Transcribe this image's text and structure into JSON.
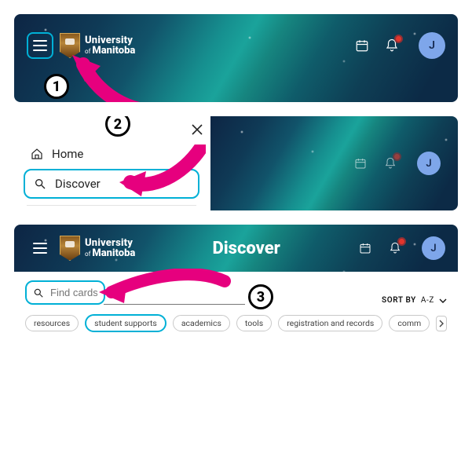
{
  "university": {
    "line1": "University",
    "line2_prefix": "of",
    "line2": "Manitoba"
  },
  "topbar": {
    "avatar_initial": "J"
  },
  "steps": {
    "one": "1",
    "two": "2",
    "three": "3"
  },
  "sidebar": {
    "home": "Home",
    "discover": "Discover"
  },
  "discover": {
    "page_title": "Discover",
    "find_placeholder": "Find cards",
    "sort_label": "SORT BY",
    "sort_value": "A-Z",
    "chips": [
      "resources",
      "student supports",
      "academics",
      "tools",
      "registration and records",
      "comm"
    ]
  }
}
